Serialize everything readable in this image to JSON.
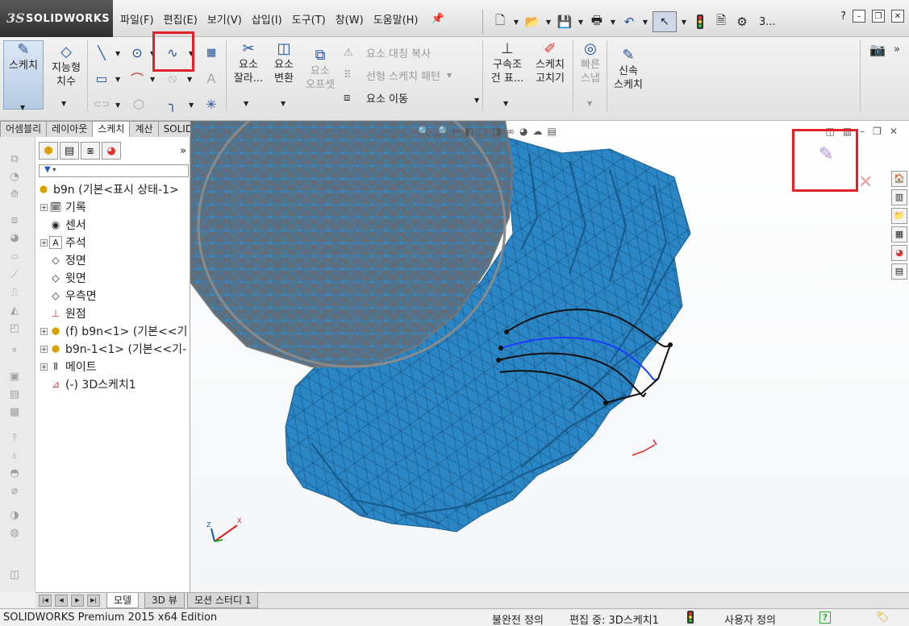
{
  "app": {
    "logo_prefix": "3S",
    "logo_text": "SOLIDWORKS"
  },
  "menu": [
    "파일(F)",
    "편집(E)",
    "보기(V)",
    "삽입(I)",
    "도구(T)",
    "창(W)",
    "도움말(H)"
  ],
  "quick_access": {
    "search_abbrev": "3...",
    "search_hint": "?"
  },
  "ribbon": {
    "sketch": "스케치",
    "smart_dim_line1": "지능형",
    "smart_dim_line2": "치수",
    "trim_line1": "요소",
    "trim_line2": "잘라...",
    "convert_line1": "요소",
    "convert_line2": "변환",
    "offset_line1": "요소",
    "offset_line2": "오프셋",
    "mirror": "요소 대칭 복사",
    "linear_pattern": "선형 스케치 패턴",
    "move": "요소 이동",
    "relations_line1": "구속조",
    "relations_line2": "건 표...",
    "repair_line1": "스케치",
    "repair_line2": "고치기",
    "snap_line1": "빠른",
    "snap_line2": "스냅",
    "rapid_line1": "신속",
    "rapid_line2": "스케치"
  },
  "command_tabs": [
    "어셈블리",
    "레이아웃",
    "스케치",
    "계산",
    "SOLIDWORKS 애드인"
  ],
  "active_command_tab": "스케치",
  "feature_tree": {
    "root": "b9n  (기본<표시 상태-1>",
    "items": [
      {
        "label": "기록",
        "icon": "history-icon",
        "expandable": true
      },
      {
        "label": "센서",
        "icon": "sensor-icon",
        "expandable": false
      },
      {
        "label": "주석",
        "icon": "annotation-icon",
        "expandable": true
      },
      {
        "label": "정면",
        "icon": "plane-icon",
        "expandable": false
      },
      {
        "label": "윗면",
        "icon": "plane-icon",
        "expandable": false
      },
      {
        "label": "우측면",
        "icon": "plane-icon",
        "expandable": false
      },
      {
        "label": "원점",
        "icon": "origin-icon",
        "expandable": false
      },
      {
        "label": "(f) b9n<1> (기본<<기",
        "icon": "part-icon",
        "expandable": true
      },
      {
        "label": "b9n-1<1> (기본<<기-",
        "icon": "part-icon",
        "expandable": true
      },
      {
        "label": "메이트",
        "icon": "mate-icon",
        "expandable": true
      },
      {
        "label": "(-) 3D스케치1",
        "icon": "sketch3d-icon",
        "expandable": false
      }
    ]
  },
  "bottom_tabs": [
    "모델",
    "3D 뷰",
    "모션 스터디 1"
  ],
  "active_bottom_tab": "모델",
  "status": {
    "product": "SOLIDWORKS Premium 2015 x64 Edition",
    "definition": "불완전 정의",
    "editing": "편집 중: 3D스케치1",
    "units": "사용자 정의",
    "help": "?"
  },
  "colors": {
    "mesh": "#2a86c4",
    "mesh_edge": "#1a5d8f",
    "highlight": "#e0222a",
    "curve_blue": "#1a3cff"
  }
}
